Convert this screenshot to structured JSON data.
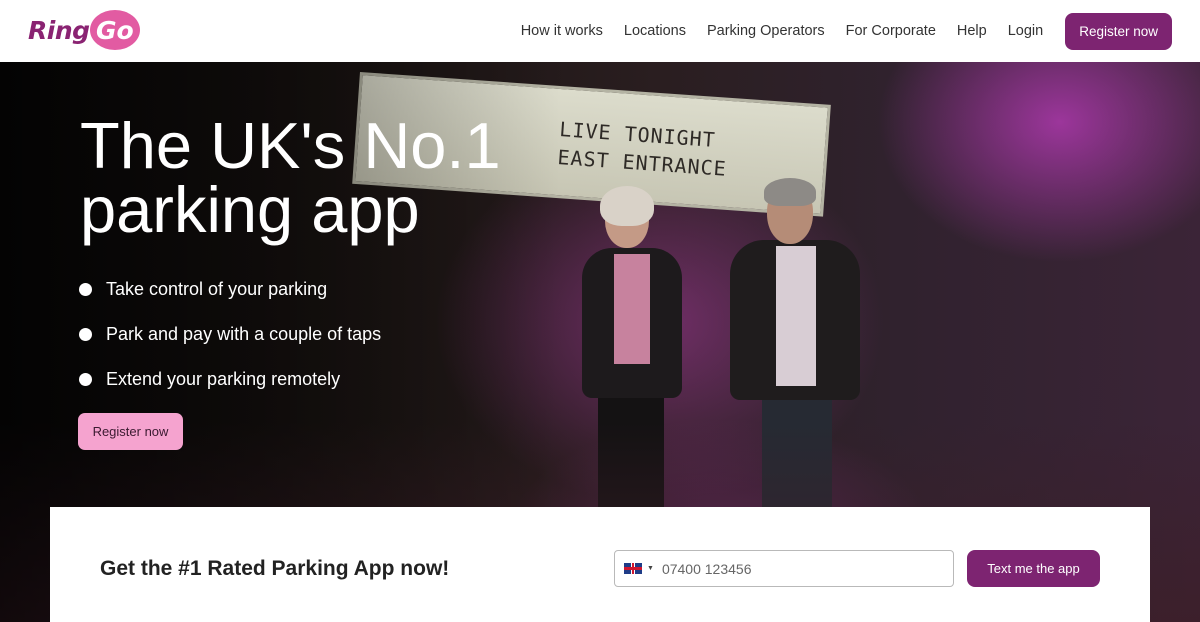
{
  "brand": {
    "logo_part1": "Ring",
    "logo_part2": "Go",
    "accent": "#7d2471",
    "pink": "#e25ba2"
  },
  "nav": {
    "items": [
      {
        "label": "How it works"
      },
      {
        "label": "Locations"
      },
      {
        "label": "Parking Operators"
      },
      {
        "label": "For Corporate"
      },
      {
        "label": "Help"
      },
      {
        "label": "Login"
      }
    ],
    "register_label": "Register now"
  },
  "hero": {
    "title": "The UK's No.1 parking app",
    "sign_line1": "LIVE TONIGHT",
    "sign_line2": "EAST ENTRANCE",
    "bullets": [
      "Take control of your parking",
      "Park and pay with a couple of taps",
      "Extend your parking remotely"
    ],
    "register_label": "Register now",
    "button_color": "#f5a3cf"
  },
  "app_card": {
    "title": "Get the #1 Rated Parking App now!",
    "phone_placeholder": "07400 123456",
    "country_icon": "uk-flag-icon",
    "submit_label": "Text me the app"
  }
}
